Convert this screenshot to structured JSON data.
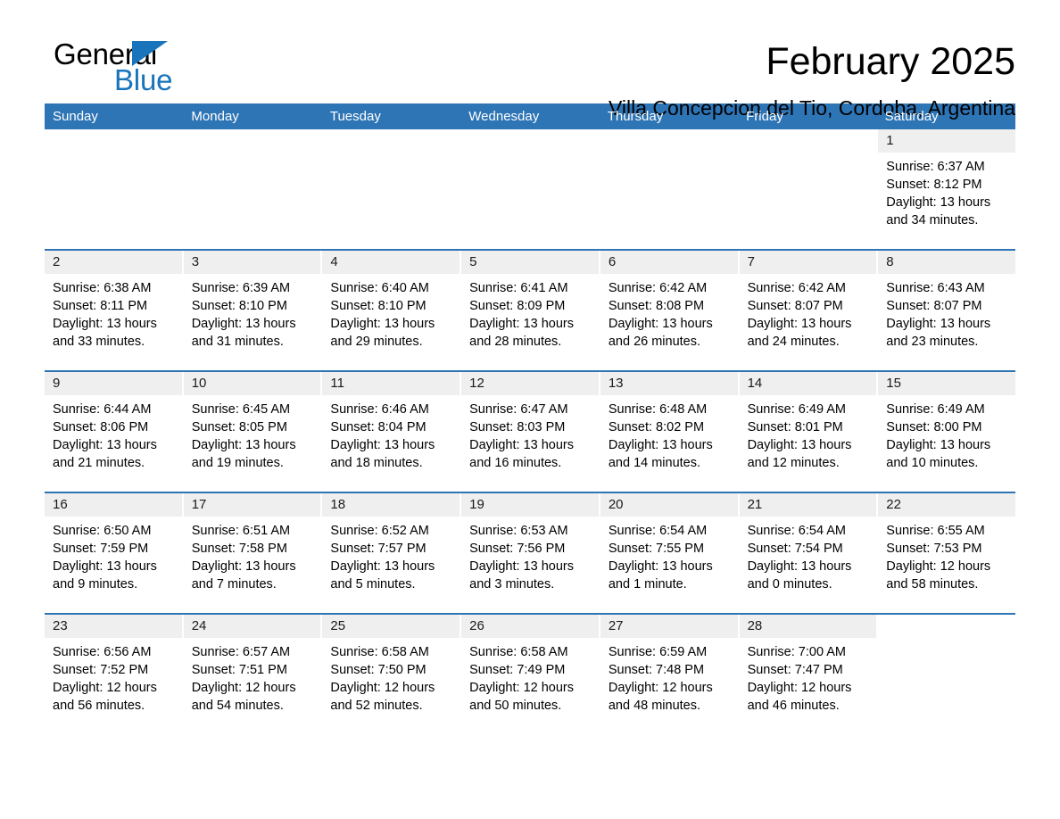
{
  "brand": {
    "name_part1": "General",
    "name_part2": "Blue",
    "accent_color": "#1974bb"
  },
  "header": {
    "month_title": "February 2025",
    "location": "Villa Concepcion del Tio, Cordoba, Argentina",
    "header_bg_color": "#2e75b6",
    "daynum_band_color": "#efefef"
  },
  "weekdays": [
    "Sunday",
    "Monday",
    "Tuesday",
    "Wednesday",
    "Thursday",
    "Friday",
    "Saturday"
  ],
  "labels": {
    "sunrise_prefix": "Sunrise:",
    "sunset_prefix": "Sunset:",
    "daylight_prefix": "Daylight:"
  },
  "weeks": [
    [
      {
        "day": "",
        "blank": true
      },
      {
        "day": "",
        "blank": true
      },
      {
        "day": "",
        "blank": true
      },
      {
        "day": "",
        "blank": true
      },
      {
        "day": "",
        "blank": true
      },
      {
        "day": "",
        "blank": true
      },
      {
        "day": "1",
        "sunrise": "Sunrise: 6:37 AM",
        "sunset": "Sunset: 8:12 PM",
        "daylight1": "Daylight: 13 hours",
        "daylight2": "and 34 minutes."
      }
    ],
    [
      {
        "day": "2",
        "sunrise": "Sunrise: 6:38 AM",
        "sunset": "Sunset: 8:11 PM",
        "daylight1": "Daylight: 13 hours",
        "daylight2": "and 33 minutes."
      },
      {
        "day": "3",
        "sunrise": "Sunrise: 6:39 AM",
        "sunset": "Sunset: 8:10 PM",
        "daylight1": "Daylight: 13 hours",
        "daylight2": "and 31 minutes."
      },
      {
        "day": "4",
        "sunrise": "Sunrise: 6:40 AM",
        "sunset": "Sunset: 8:10 PM",
        "daylight1": "Daylight: 13 hours",
        "daylight2": "and 29 minutes."
      },
      {
        "day": "5",
        "sunrise": "Sunrise: 6:41 AM",
        "sunset": "Sunset: 8:09 PM",
        "daylight1": "Daylight: 13 hours",
        "daylight2": "and 28 minutes."
      },
      {
        "day": "6",
        "sunrise": "Sunrise: 6:42 AM",
        "sunset": "Sunset: 8:08 PM",
        "daylight1": "Daylight: 13 hours",
        "daylight2": "and 26 minutes."
      },
      {
        "day": "7",
        "sunrise": "Sunrise: 6:42 AM",
        "sunset": "Sunset: 8:07 PM",
        "daylight1": "Daylight: 13 hours",
        "daylight2": "and 24 minutes."
      },
      {
        "day": "8",
        "sunrise": "Sunrise: 6:43 AM",
        "sunset": "Sunset: 8:07 PM",
        "daylight1": "Daylight: 13 hours",
        "daylight2": "and 23 minutes."
      }
    ],
    [
      {
        "day": "9",
        "sunrise": "Sunrise: 6:44 AM",
        "sunset": "Sunset: 8:06 PM",
        "daylight1": "Daylight: 13 hours",
        "daylight2": "and 21 minutes."
      },
      {
        "day": "10",
        "sunrise": "Sunrise: 6:45 AM",
        "sunset": "Sunset: 8:05 PM",
        "daylight1": "Daylight: 13 hours",
        "daylight2": "and 19 minutes."
      },
      {
        "day": "11",
        "sunrise": "Sunrise: 6:46 AM",
        "sunset": "Sunset: 8:04 PM",
        "daylight1": "Daylight: 13 hours",
        "daylight2": "and 18 minutes."
      },
      {
        "day": "12",
        "sunrise": "Sunrise: 6:47 AM",
        "sunset": "Sunset: 8:03 PM",
        "daylight1": "Daylight: 13 hours",
        "daylight2": "and 16 minutes."
      },
      {
        "day": "13",
        "sunrise": "Sunrise: 6:48 AM",
        "sunset": "Sunset: 8:02 PM",
        "daylight1": "Daylight: 13 hours",
        "daylight2": "and 14 minutes."
      },
      {
        "day": "14",
        "sunrise": "Sunrise: 6:49 AM",
        "sunset": "Sunset: 8:01 PM",
        "daylight1": "Daylight: 13 hours",
        "daylight2": "and 12 minutes."
      },
      {
        "day": "15",
        "sunrise": "Sunrise: 6:49 AM",
        "sunset": "Sunset: 8:00 PM",
        "daylight1": "Daylight: 13 hours",
        "daylight2": "and 10 minutes."
      }
    ],
    [
      {
        "day": "16",
        "sunrise": "Sunrise: 6:50 AM",
        "sunset": "Sunset: 7:59 PM",
        "daylight1": "Daylight: 13 hours",
        "daylight2": "and 9 minutes."
      },
      {
        "day": "17",
        "sunrise": "Sunrise: 6:51 AM",
        "sunset": "Sunset: 7:58 PM",
        "daylight1": "Daylight: 13 hours",
        "daylight2": "and 7 minutes."
      },
      {
        "day": "18",
        "sunrise": "Sunrise: 6:52 AM",
        "sunset": "Sunset: 7:57 PM",
        "daylight1": "Daylight: 13 hours",
        "daylight2": "and 5 minutes."
      },
      {
        "day": "19",
        "sunrise": "Sunrise: 6:53 AM",
        "sunset": "Sunset: 7:56 PM",
        "daylight1": "Daylight: 13 hours",
        "daylight2": "and 3 minutes."
      },
      {
        "day": "20",
        "sunrise": "Sunrise: 6:54 AM",
        "sunset": "Sunset: 7:55 PM",
        "daylight1": "Daylight: 13 hours",
        "daylight2": "and 1 minute."
      },
      {
        "day": "21",
        "sunrise": "Sunrise: 6:54 AM",
        "sunset": "Sunset: 7:54 PM",
        "daylight1": "Daylight: 13 hours",
        "daylight2": "and 0 minutes."
      },
      {
        "day": "22",
        "sunrise": "Sunrise: 6:55 AM",
        "sunset": "Sunset: 7:53 PM",
        "daylight1": "Daylight: 12 hours",
        "daylight2": "and 58 minutes."
      }
    ],
    [
      {
        "day": "23",
        "sunrise": "Sunrise: 6:56 AM",
        "sunset": "Sunset: 7:52 PM",
        "daylight1": "Daylight: 12 hours",
        "daylight2": "and 56 minutes."
      },
      {
        "day": "24",
        "sunrise": "Sunrise: 6:57 AM",
        "sunset": "Sunset: 7:51 PM",
        "daylight1": "Daylight: 12 hours",
        "daylight2": "and 54 minutes."
      },
      {
        "day": "25",
        "sunrise": "Sunrise: 6:58 AM",
        "sunset": "Sunset: 7:50 PM",
        "daylight1": "Daylight: 12 hours",
        "daylight2": "and 52 minutes."
      },
      {
        "day": "26",
        "sunrise": "Sunrise: 6:58 AM",
        "sunset": "Sunset: 7:49 PM",
        "daylight1": "Daylight: 12 hours",
        "daylight2": "and 50 minutes."
      },
      {
        "day": "27",
        "sunrise": "Sunrise: 6:59 AM",
        "sunset": "Sunset: 7:48 PM",
        "daylight1": "Daylight: 12 hours",
        "daylight2": "and 48 minutes."
      },
      {
        "day": "28",
        "sunrise": "Sunrise: 7:00 AM",
        "sunset": "Sunset: 7:47 PM",
        "daylight1": "Daylight: 12 hours",
        "daylight2": "and 46 minutes."
      },
      {
        "day": "",
        "blank": true
      }
    ]
  ]
}
